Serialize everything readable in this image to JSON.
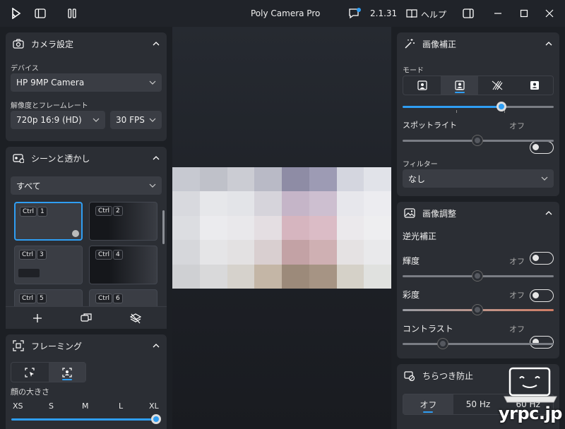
{
  "titlebar": {
    "title": "Poly Camera Pro",
    "version": "2.1.31",
    "help_label": "ヘルプ"
  },
  "camera_settings": {
    "title": "カメラ設定",
    "device_label": "デバイス",
    "device_value": "HP 9MP Camera",
    "resolution_label": "解像度とフレームレート",
    "resolution_value": "720p 16:9 (HD)",
    "fps_value": "30 FPS"
  },
  "scenes": {
    "title": "シーンと透かし",
    "filter_value": "すべて",
    "items": [
      {
        "key": "Ctrl",
        "num": "1"
      },
      {
        "key": "Ctrl",
        "num": "2"
      },
      {
        "key": "Ctrl",
        "num": "3"
      },
      {
        "key": "Ctrl",
        "num": "4"
      },
      {
        "key": "Ctrl",
        "num": "5"
      },
      {
        "key": "Ctrl",
        "num": "6"
      }
    ]
  },
  "framing": {
    "title": "フレーミング",
    "face_size_label": "顔の大きさ",
    "sizes": [
      "XS",
      "S",
      "M",
      "L",
      "XL"
    ],
    "face_size_level": 1.0
  },
  "image_correction": {
    "title": "画像補正",
    "mode_label": "モード",
    "mode_level": 0.68,
    "spotlight_label": "スポットライト",
    "spotlight_state": "オフ",
    "spotlight_level": 0.5,
    "filter_label": "フィルター",
    "filter_value": "なし"
  },
  "image_adjust": {
    "title": "画像調整",
    "backlight_label": "逆光補正",
    "brightness_label": "輝度",
    "brightness_state": "オフ",
    "brightness_level": 0.5,
    "saturation_label": "彩度",
    "saturation_state": "オフ",
    "saturation_level": 0.5,
    "contrast_label": "コントラスト",
    "contrast_state": "オフ",
    "contrast_level": 0.27
  },
  "flicker": {
    "title": "ちらつき防止",
    "options": [
      "オフ",
      "50 Hz",
      "60 Hz"
    ]
  },
  "watermark": {
    "text": "yrpc.jp"
  },
  "colors": {
    "accent": "#2f9ef3",
    "panel": "#2b2e34",
    "background": "#1c1f24"
  }
}
